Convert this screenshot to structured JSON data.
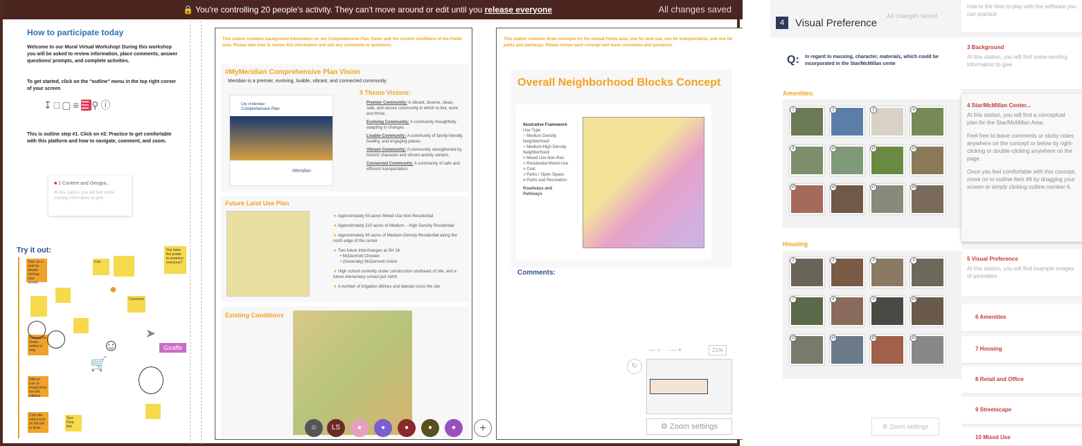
{
  "topbar": {
    "message_prefix": "You're controlling 20 people's activity. They can't move around or edit until you",
    "release_link": "release everyone",
    "saved": "All changes saved"
  },
  "howto": {
    "title": "How to participate today",
    "welcome": "Welcome to our Mural Virtual Workshop! During this workshop you will be asked to review information, place comments, answer questions/ prompts, and complete activities.",
    "started": "To get started, click on the \"outline\" menu in the top right corner of your screen",
    "outline_step": "This is outline step #1. Click on #2: Practice to get comfortable with this platform and how to navigate, comment, and zoom.",
    "card_title": "2 Context and Geogra...",
    "card_desc": "At this station, you will find some existing information to give",
    "try": "Try it out:",
    "power_note": "You have the power to summon everyone?",
    "cursor_name": "Giraffe",
    "sticky_start": "Start on a note by double clicking your mouse",
    "sticky_icon": "Icon",
    "sticky_comment": "Comment",
    "sticky_connect": "Connect to shape button to help",
    "sticky_image": "Add an icon or image from the left sidebar",
    "sticky_select": "Click the select icon on the left to draw",
    "sticky_text": "Text Drop box"
  },
  "frame1": {
    "intro": "This station contains background information on our Comprehensive Plan Vision and the current conditions of the Fields area. Please take time to review this information and add any comments or questions.",
    "vision_title": "#MyMeridian Comprehensive Plan Vision",
    "vision_sub": "Meridian is a premier, evolving, livable, vibrant, and connected community",
    "doc_city": "City of Meridian",
    "doc_title": "Comprehensive Plan",
    "doc_logo": "Meridian",
    "themes_title": "5 Theme Visions:",
    "themes": [
      {
        "name": "Premier Community:",
        "desc": "A vibrant, diverse, clean, safe, and secure community in which to live, work, and thrive."
      },
      {
        "name": "Evolving Community:",
        "desc": "A community thoughtfully adapting to changes."
      },
      {
        "name": "Livable Community:",
        "desc": "A community of family-friendly, healthy, and engaging places."
      },
      {
        "name": "Vibrant Community:",
        "desc": "A community strengthened by historic character and vibrant activity centers."
      },
      {
        "name": "Connected Community:",
        "desc": "A community of safe and efficient transportation."
      }
    ],
    "landuse_title": "Future Land Use Plan",
    "landuse_items": [
      "Approximately 50-acres Mixed Use Non-Residential",
      "Approximately 210 acres of Medium – High Density Residential",
      "Approximately 40 acres of Medium-Density Residential along the north edge of the center",
      "Two future interchanges at SH 16:",
      "High school currently under construction southeast of site, and a future elementary school just north",
      "A number of irrigation ditches and laterals cross the site"
    ],
    "interchanges": [
      "McDermott Chinden",
      "(Generally) McDermott Ustick"
    ],
    "existing_title": "Existing Conditions"
  },
  "frame2": {
    "intro": "This station contains three concepts for the overall Fields area; one for land use, one for transportation, and one for parks and pathways. Please review each concept and leave comments and questions.",
    "title": "Overall Neighborhood Blocks Concept",
    "legend_title": "Illustrative Framework",
    "legend_sub": "Use Type",
    "legend_items": [
      "Medium Density Neighborhood",
      "Medium-High Density Neighborhood",
      "Mixed Use Non-Res.",
      "Residential Mixed-Use",
      "Civic",
      "Parks / Open Space",
      "Parks and Recreation"
    ],
    "roads_title": "Roadways and Pathways",
    "comments": "Comments:",
    "zoom_pct": "21%",
    "zoom_settings": "Zoom settings"
  },
  "avatars": [
    "LS"
  ],
  "right": {
    "section_num": "4",
    "section_title": "Visual Preference",
    "saved": "All changes saved",
    "question_label": "Q:",
    "question": "In regard to massing, character, materials, which could be incorporated in the Star/McMillan cente",
    "amenities": "Amenities:",
    "housing": "Housing",
    "zoom_settings": "Zoom settings"
  },
  "outline": {
    "top_desc": "how to the time to play with the software you can practice",
    "items": [
      {
        "title": "3 Background",
        "desc": "At this station, you will find some existing information to give"
      },
      {
        "title": "4 Star/McMillan Center...",
        "desc": "At this station, you will find a conceptual plan for the Star/McMillan Area.",
        "desc2": "Feel free to leave comments or sticky notes anywhere on the concept or below by right-clicking or double-clicking anywhere on the page.",
        "desc3": "Once you feel comfortable with this concept, move on to outline item #6 by dragging your screen or simply clicking outline number 6."
      },
      {
        "title": "5 Visual Preference",
        "desc": "At this station, you will find example images of amenities"
      },
      {
        "title": "6 Amenities"
      },
      {
        "title": "7 Housing"
      },
      {
        "title": "8 Retail and Office"
      },
      {
        "title": "9 Streetscape"
      },
      {
        "title": "10 Mixed Use"
      }
    ]
  },
  "colors": {
    "topbar": "#4b2520",
    "accent_orange": "#f3a21e",
    "accent_red": "#c43a3a",
    "blue": "#2f6fb4"
  }
}
